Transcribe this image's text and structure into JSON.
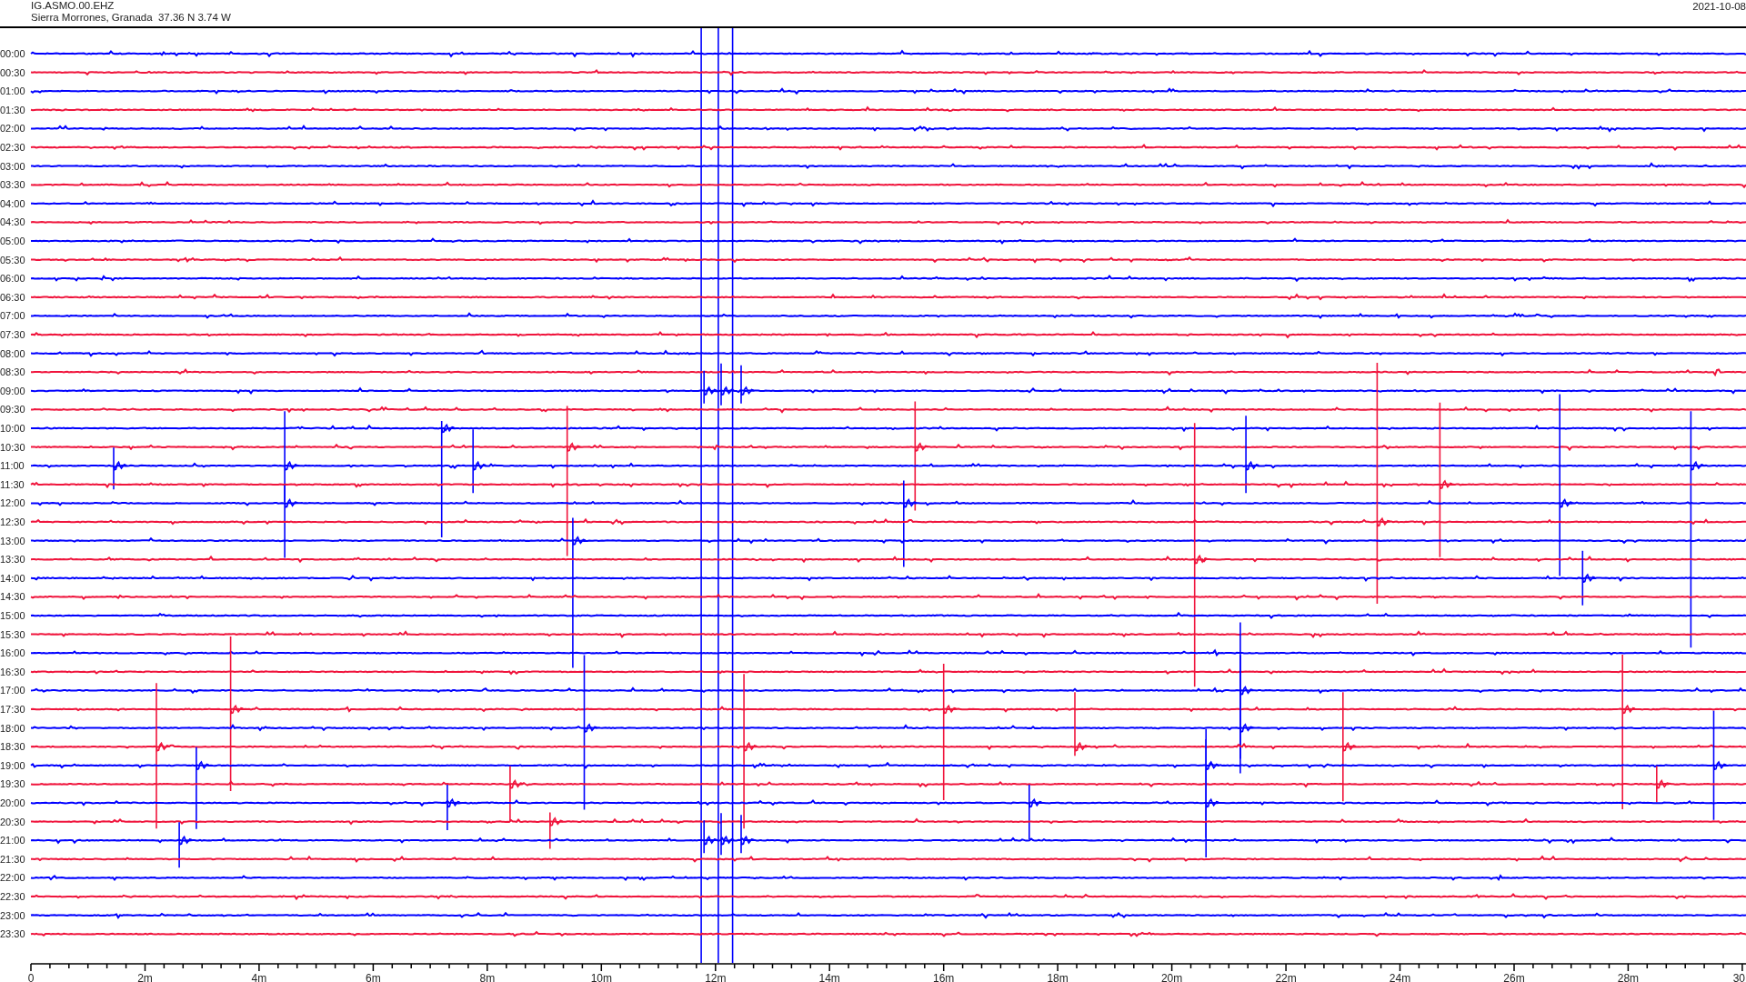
{
  "header": {
    "station": "IG.ASMO.00.EHZ",
    "location": "Sierra Morrones, Granada  37.36 N 3.74 W",
    "date": "2021-10-08"
  },
  "traces": [
    {
      "label": "00:00",
      "color": "#0000ff"
    },
    {
      "label": "00:30",
      "color": "#f0143c"
    },
    {
      "label": "01:00",
      "color": "#0000ff"
    },
    {
      "label": "01:30",
      "color": "#f0143c"
    },
    {
      "label": "02:00",
      "color": "#0000ff"
    },
    {
      "label": "02:30",
      "color": "#f0143c"
    },
    {
      "label": "03:00",
      "color": "#0000ff"
    },
    {
      "label": "03:30",
      "color": "#f0143c"
    },
    {
      "label": "04:00",
      "color": "#0000ff"
    },
    {
      "label": "04:30",
      "color": "#f0143c"
    },
    {
      "label": "05:00",
      "color": "#0000ff"
    },
    {
      "label": "05:30",
      "color": "#f0143c"
    },
    {
      "label": "06:00",
      "color": "#0000ff"
    },
    {
      "label": "06:30",
      "color": "#f0143c"
    },
    {
      "label": "07:00",
      "color": "#0000ff"
    },
    {
      "label": "07:30",
      "color": "#f0143c"
    },
    {
      "label": "08:00",
      "color": "#0000ff"
    },
    {
      "label": "08:30",
      "color": "#f0143c"
    },
    {
      "label": "09:00",
      "color": "#0000ff"
    },
    {
      "label": "09:30",
      "color": "#f0143c"
    },
    {
      "label": "10:00",
      "color": "#0000ff"
    },
    {
      "label": "10:30",
      "color": "#f0143c"
    },
    {
      "label": "11:00",
      "color": "#0000ff"
    },
    {
      "label": "11:30",
      "color": "#f0143c"
    },
    {
      "label": "12:00",
      "color": "#0000ff"
    },
    {
      "label": "12:30",
      "color": "#f0143c"
    },
    {
      "label": "13:00",
      "color": "#0000ff"
    },
    {
      "label": "13:30",
      "color": "#f0143c"
    },
    {
      "label": "14:00",
      "color": "#0000ff"
    },
    {
      "label": "14:30",
      "color": "#f0143c"
    },
    {
      "label": "15:00",
      "color": "#0000ff"
    },
    {
      "label": "15:30",
      "color": "#f0143c"
    },
    {
      "label": "16:00",
      "color": "#0000ff"
    },
    {
      "label": "16:30",
      "color": "#f0143c"
    },
    {
      "label": "17:00",
      "color": "#0000ff"
    },
    {
      "label": "17:30",
      "color": "#f0143c"
    },
    {
      "label": "18:00",
      "color": "#0000ff"
    },
    {
      "label": "18:30",
      "color": "#f0143c"
    },
    {
      "label": "19:00",
      "color": "#0000ff"
    },
    {
      "label": "19:30",
      "color": "#f0143c"
    },
    {
      "label": "20:00",
      "color": "#0000ff"
    },
    {
      "label": "20:30",
      "color": "#f0143c"
    },
    {
      "label": "21:00",
      "color": "#0000ff"
    },
    {
      "label": "21:30",
      "color": "#f0143c"
    },
    {
      "label": "22:00",
      "color": "#0000ff"
    },
    {
      "label": "22:30",
      "color": "#f0143c"
    },
    {
      "label": "23:00",
      "color": "#0000ff"
    },
    {
      "label": "23:30",
      "color": "#f0143c"
    }
  ],
  "x_axis": {
    "labels": [
      "0",
      "2m",
      "4m",
      "6m",
      "8m",
      "10m",
      "12m",
      "14m",
      "16m",
      "18m",
      "20m",
      "22m",
      "24m",
      "26m",
      "28m",
      "30"
    ]
  }
}
